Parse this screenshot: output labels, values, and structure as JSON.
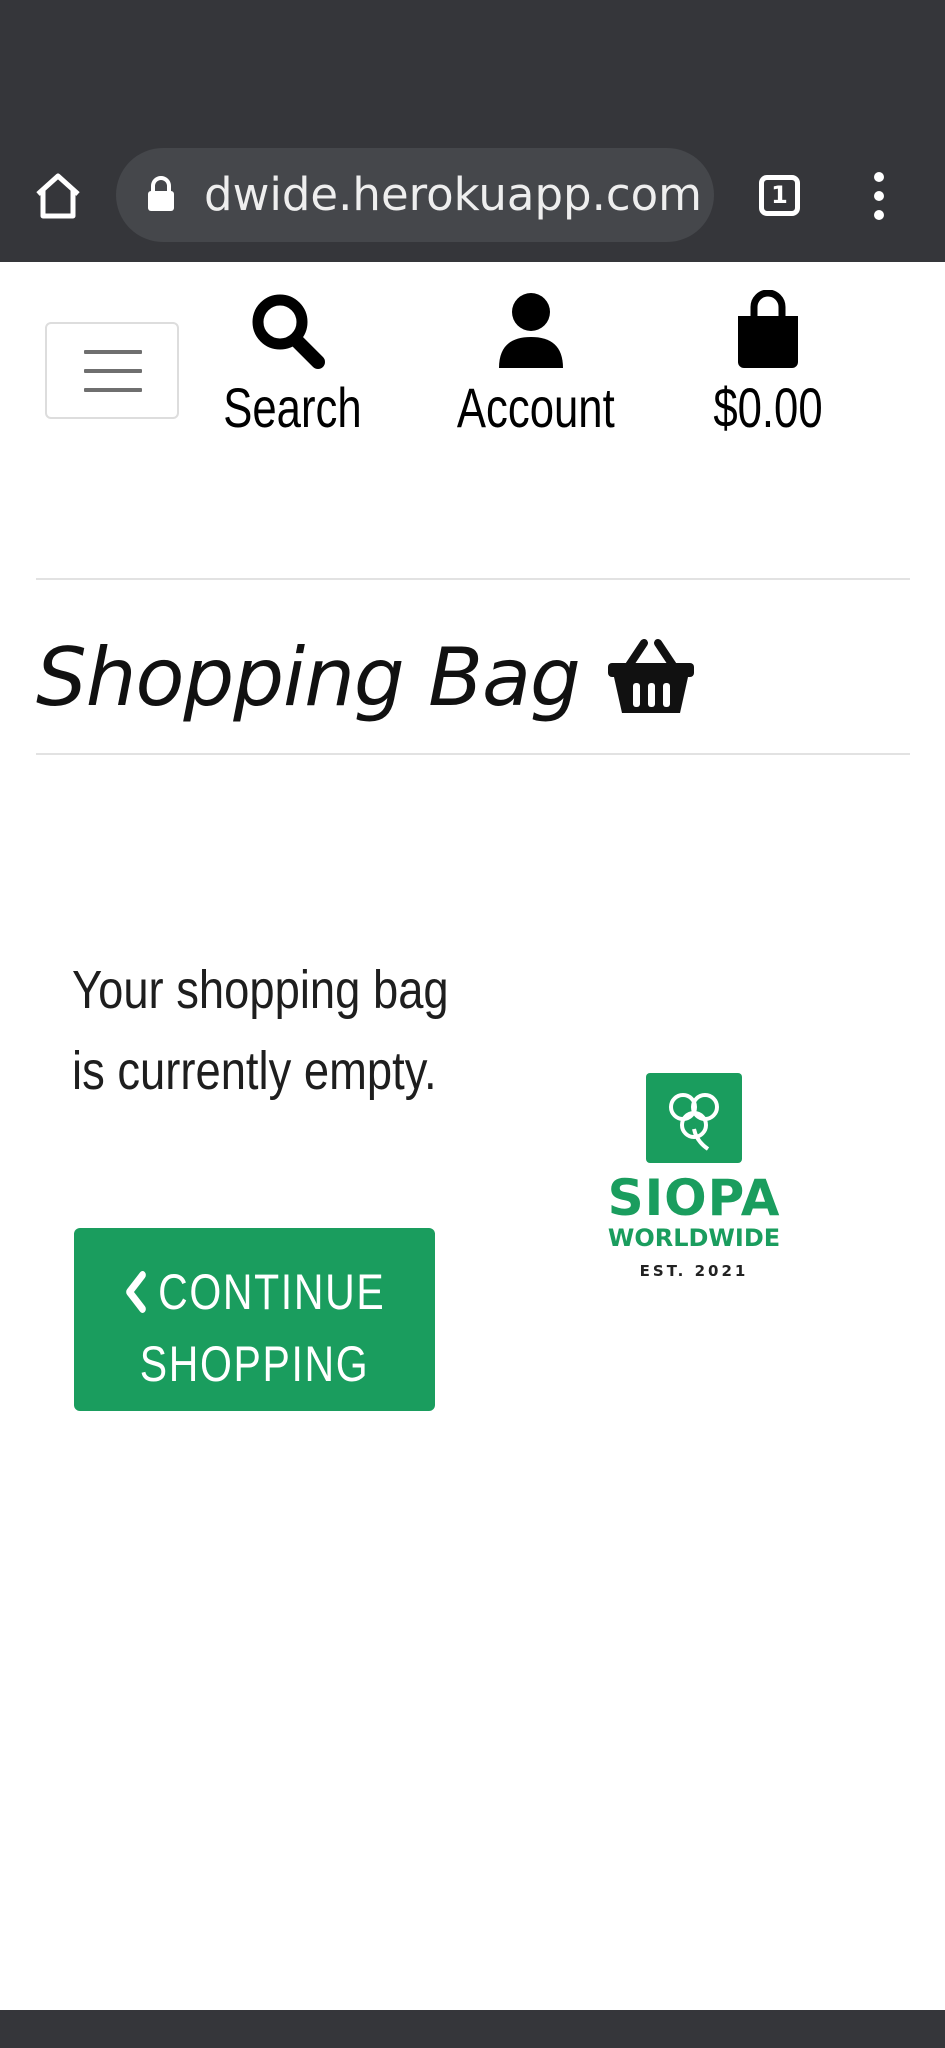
{
  "browser": {
    "url": "dwide.herokuapp.com",
    "tab_count": "1",
    "home_icon": "home-icon",
    "lock_icon": "lock-icon",
    "menu_icon": "more-vert-icon"
  },
  "nav": {
    "toggle_icon": "hamburger-icon",
    "search_label": "Search",
    "account_label": "Account",
    "bag_total": "$0.00"
  },
  "page": {
    "title": "Shopping Bag",
    "title_icon": "basket-icon"
  },
  "bag": {
    "empty_message": "Your shopping bag is currently empty.",
    "continue_button": "CONTINUE SHOPPING",
    "continue_icon": "chevron-left-icon"
  },
  "logo": {
    "name": "SIOPA",
    "tagline": "WORLDWIDE",
    "established": "EST. 2021",
    "icon": "shamrock-icon"
  },
  "colors": {
    "brand_green": "#1a9d5e",
    "browser_chrome": "#35363a"
  }
}
